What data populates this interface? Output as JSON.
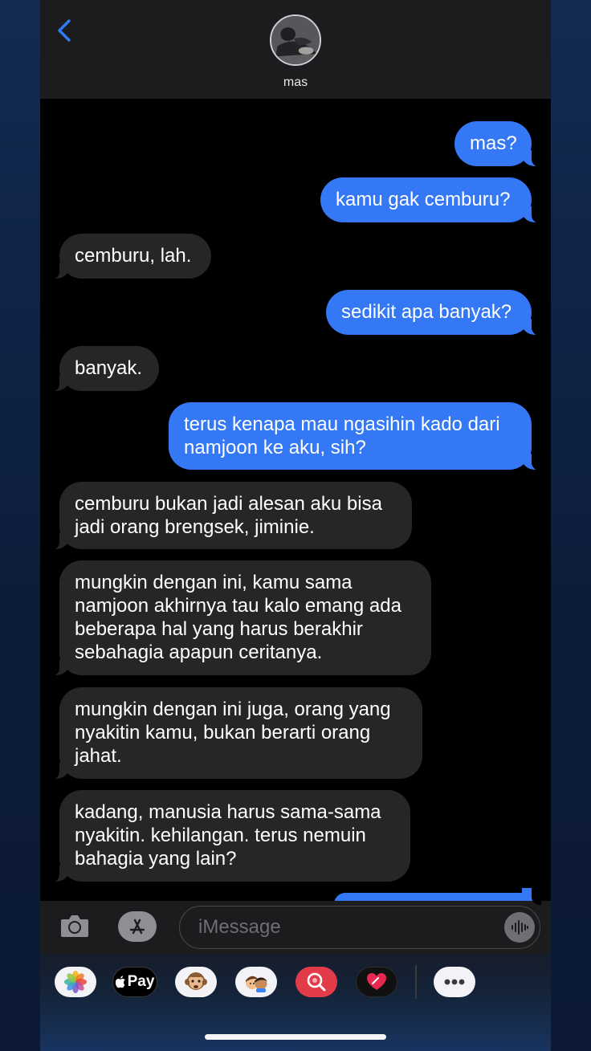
{
  "header": {
    "contact_name": "mas",
    "back_icon": "chevron-left-icon",
    "avatar_icon": "contact-photo"
  },
  "messages": [
    {
      "sender": "me",
      "text": "mas?"
    },
    {
      "sender": "me",
      "text": "kamu gak cemburu?"
    },
    {
      "sender": "them",
      "text": "cemburu, lah."
    },
    {
      "sender": "me",
      "text": "sedikit apa banyak?"
    },
    {
      "sender": "them",
      "text": "banyak."
    },
    {
      "sender": "me",
      "text": "terus kenapa mau ngasihin kado dari\nnamjoon ke aku, sih?"
    },
    {
      "sender": "them",
      "text": "cemburu bukan jadi alesan aku bisa\njadi orang brengsek, jiminie."
    },
    {
      "sender": "them",
      "text": "mungkin dengan ini, kamu sama\nnamjoon akhirnya tau kalo emang ada\nbeberapa hal yang harus berakhir\nsebahagia apapun ceritanya."
    },
    {
      "sender": "them",
      "text": "mungkin dengan ini juga, orang yang\nnyakitin kamu, bukan berarti orang\njahat."
    },
    {
      "sender": "them",
      "text": "kadang, manusia harus sama-sama\nnyakitin. kehilangan. terus nemuin\nbahagia yang lain?"
    },
    {
      "sender": "me",
      "text": ""
    }
  ],
  "input_bar": {
    "placeholder": "iMessage",
    "camera_icon": "camera-icon",
    "apps_icon": "app-store-icon",
    "audio_icon": "audio-waveform-icon"
  },
  "app_drawer": {
    "apple_pay_label": "Pay",
    "apps": [
      "photos-icon",
      "apple-pay-icon",
      "animoji-monkey-icon",
      "memoji-stickers-icon",
      "image-search-icon",
      "digital-touch-heart-icon",
      "more-icon"
    ]
  },
  "colors": {
    "sent_bubble": "#3478f6",
    "received_bubble": "#262628",
    "header": "#1c1c1e"
  }
}
